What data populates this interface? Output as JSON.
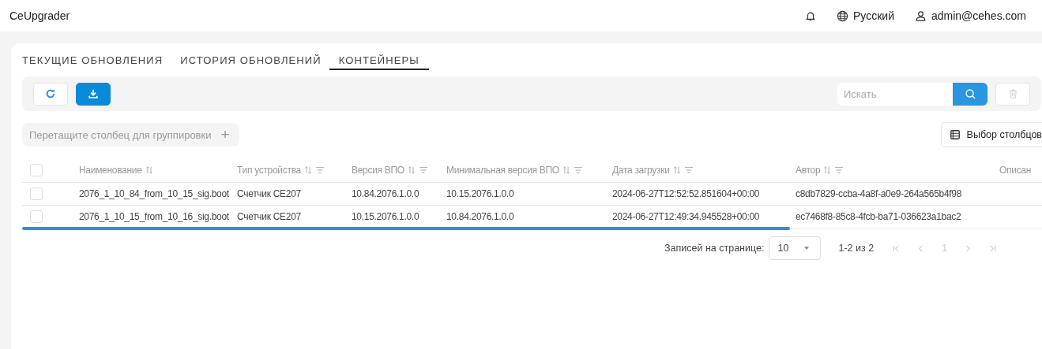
{
  "app": {
    "title": "CeUpgrader"
  },
  "header": {
    "language": "Русский",
    "user": "admin@cehes.com"
  },
  "tabs": [
    {
      "label": "ТЕКУЩИЕ ОБНОВЛЕНИЯ",
      "selected": false
    },
    {
      "label": "ИСТОРИЯ ОБНОВЛЕНИЙ",
      "selected": false
    },
    {
      "label": "КОНТЕЙНЕРЫ",
      "selected": true
    }
  ],
  "search": {
    "placeholder": "Искать"
  },
  "grouping": {
    "placeholder": "Перетащите столбец для группировки",
    "add": "+"
  },
  "column_chooser": {
    "label": "Выбор столбцов"
  },
  "table": {
    "select_all": {
      "checked": false
    },
    "columns": [
      {
        "label": "Наименование",
        "filter": false
      },
      {
        "label": "Тип устройства",
        "filter": true
      },
      {
        "label": "Версия ВПО",
        "filter": true
      },
      {
        "label": "Минимальная версия ВПО",
        "filter": true
      },
      {
        "label": "Дата загрузки",
        "filter": true
      },
      {
        "label": "Автор",
        "filter": true
      },
      {
        "label": "Описан",
        "filter": false
      }
    ],
    "rows": [
      {
        "checked": false,
        "cells": [
          "2076_1_10_84_from_10_15_sig.boot",
          "Счетчик CE207",
          "10.84.2076.1.0.0",
          "10.15.2076.1.0.0",
          "2024-06-27T12:52:52.851604+00:00",
          "c8db7829-ccba-4a8f-a0e9-264a565b4f98"
        ]
      },
      {
        "checked": false,
        "cells": [
          "2076_1_10_15_from_10_16_sig.boot",
          "Счетчик CE207",
          "10.15.2076.1.0.0",
          "10.84.2076.1.0.0",
          "2024-06-27T12:49:34.945528+00:00",
          "ec7468f8-85c8-4fcb-ba71-036623a1bac2"
        ]
      }
    ]
  },
  "pagination": {
    "label": "Записей на странице:",
    "page_size": "10",
    "range": "1-2 из 2",
    "page": "1"
  }
}
